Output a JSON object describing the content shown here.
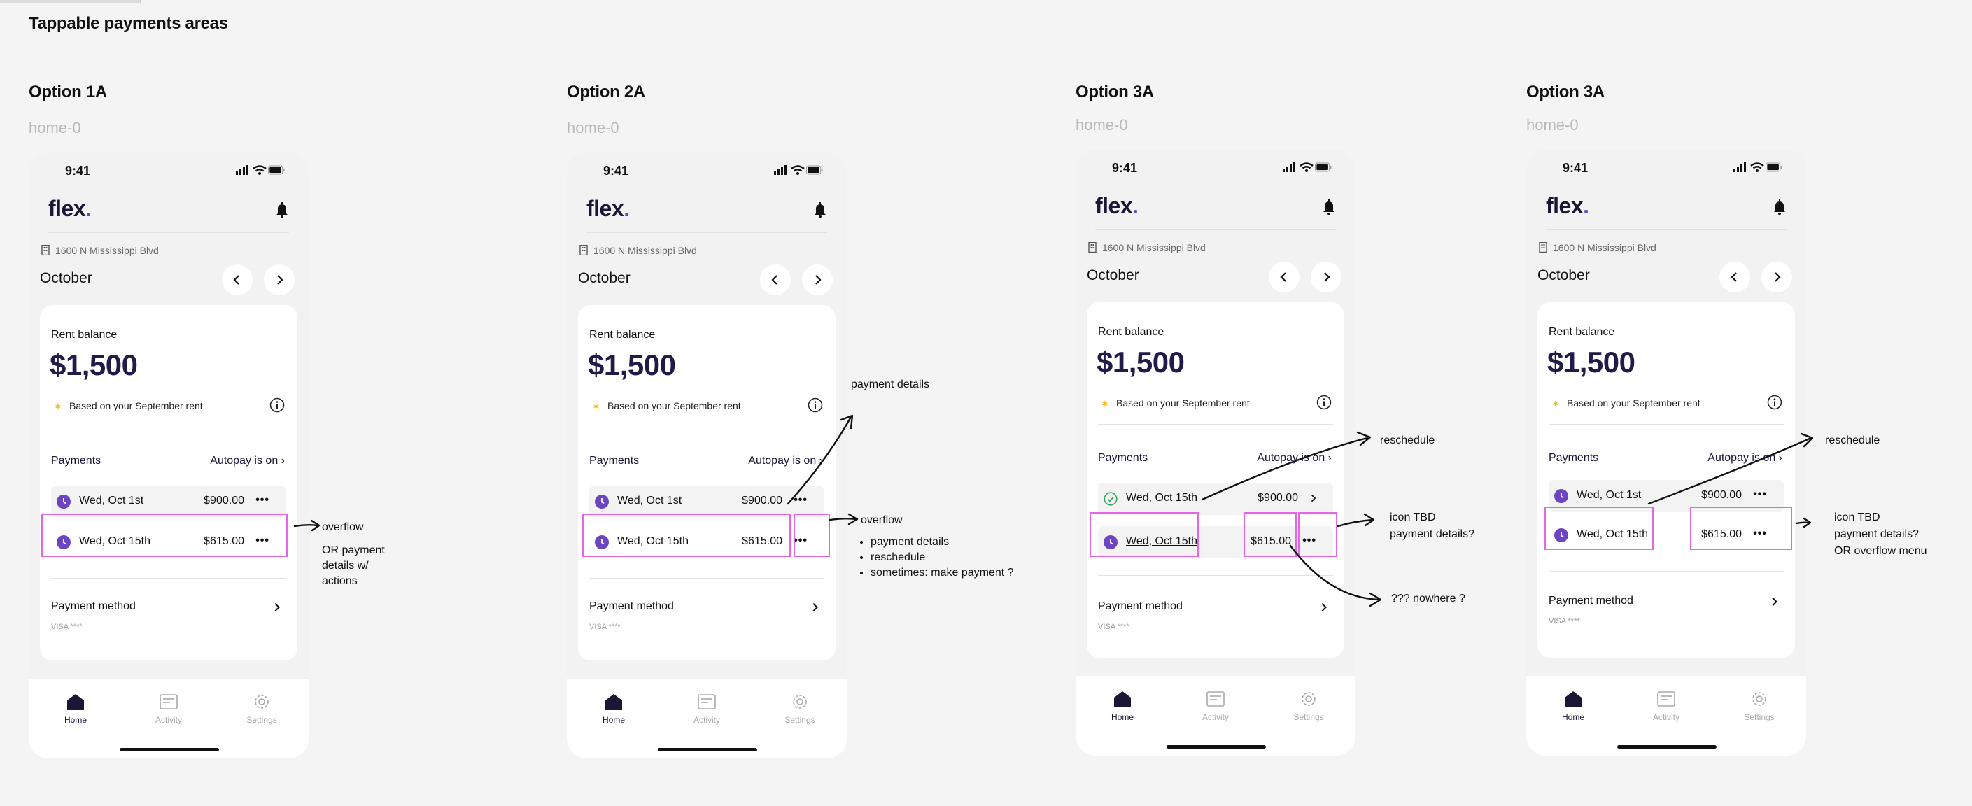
{
  "page_title": "Tappable payments areas",
  "frame_name": "home-0",
  "colors": {
    "brand": "#1d1536",
    "accent": "#6b45c2",
    "highlight": "#e466e6",
    "star": "#f5b50a",
    "paid_green": "#3aa463"
  },
  "phone": {
    "time": "9:41",
    "logo": "flex",
    "logo_dot": ".",
    "address": "1600 N Mississippi Blvd",
    "month": "October",
    "rent_label": "Rent balance",
    "rent_amount": "$1,500",
    "based_on": "Based on your September rent",
    "payments_label": "Payments",
    "autopay": "Autopay is on",
    "payment_method": "Payment method",
    "visa": "VISA ****",
    "tabs": [
      "Home",
      "Activity",
      "Settings"
    ],
    "icons": [
      "signal-icon",
      "wifi-icon",
      "battery-icon",
      "bell-icon",
      "building-icon",
      "chevron-left-icon",
      "chevron-right-icon",
      "info-icon",
      "clock-icon",
      "check-circle-icon",
      "more-icon",
      "home-icon",
      "activity-icon",
      "gear-icon"
    ]
  },
  "options": [
    {
      "title": "Option 1A",
      "rows": [
        {
          "date": "Wed, Oct 1st",
          "amount": "$900.00",
          "status": "scheduled",
          "trailing": "more"
        },
        {
          "date": "Wed, Oct 15th",
          "amount": "$615.00",
          "status": "scheduled",
          "trailing": "more"
        }
      ],
      "notes": {
        "overflow": "overflow",
        "or_details_1": "OR payment",
        "or_details_2": "details w/",
        "or_details_3": "actions"
      }
    },
    {
      "title": "Option 2A",
      "rows": [
        {
          "date": "Wed, Oct 1st",
          "amount": "$900.00",
          "status": "scheduled",
          "trailing": "more"
        },
        {
          "date": "Wed, Oct 15th",
          "amount": "$615.00",
          "status": "scheduled",
          "trailing": "more"
        }
      ],
      "notes": {
        "payment_details": "payment details",
        "overflow": "overflow",
        "bullets": [
          "payment details",
          "reschedule",
          "sometimes: make payment ?"
        ]
      }
    },
    {
      "title": "Option 3A",
      "rows": [
        {
          "date": "Wed, Oct 15th",
          "amount": "$900.00",
          "status": "paid",
          "trailing": "chevron"
        },
        {
          "date": "Wed, Oct 15th",
          "amount": "$615.00",
          "status": "scheduled",
          "trailing": "more"
        }
      ],
      "notes": {
        "reschedule": "reschedule",
        "icon_tbd": "icon TBD",
        "payment_details_q": "payment details?",
        "nowhere": "??? nowhere ?"
      }
    },
    {
      "title": "Option 3A",
      "rows": [
        {
          "date": "Wed, Oct 1st",
          "amount": "$900.00",
          "status": "scheduled",
          "trailing": "more"
        },
        {
          "date": "Wed, Oct 15th",
          "amount": "$615.00",
          "status": "scheduled",
          "trailing": "more"
        }
      ],
      "notes": {
        "reschedule": "reschedule",
        "icon_tbd": "icon TBD",
        "payment_details_q": "payment details?",
        "or_overflow": "OR overflow menu"
      }
    }
  ]
}
